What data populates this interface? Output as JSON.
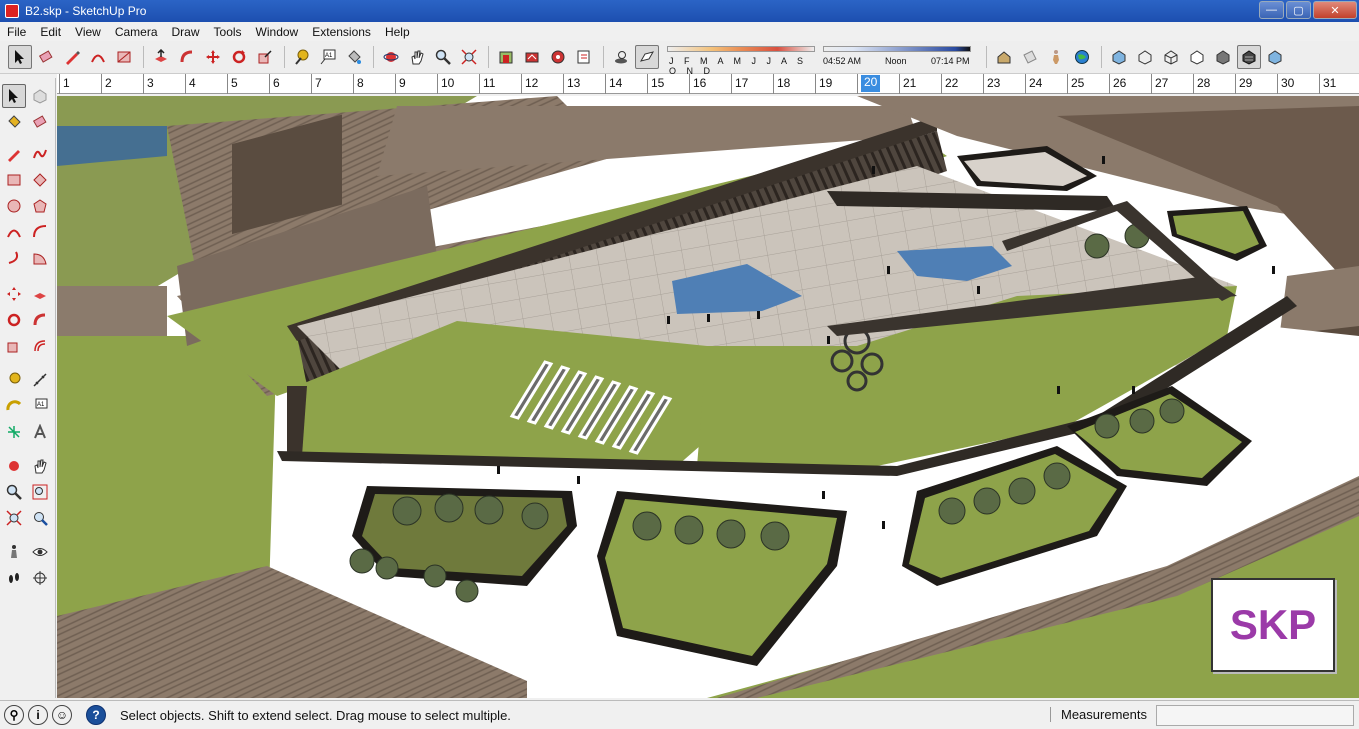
{
  "window": {
    "title": "B2.skp - SketchUp Pro",
    "minimize": "—",
    "maximize": "▢",
    "close": "✕"
  },
  "menu": [
    "File",
    "Edit",
    "View",
    "Camera",
    "Draw",
    "Tools",
    "Window",
    "Extensions",
    "Help"
  ],
  "shadows": {
    "months": "J F M A M J J A S O N D",
    "time_start": "04:52 AM",
    "time_mid": "Noon",
    "time_end": "07:14 PM"
  },
  "ruler": {
    "numbers": [
      "1",
      "2",
      "3",
      "4",
      "5",
      "6",
      "7",
      "8",
      "9",
      "10",
      "11",
      "12",
      "13",
      "14",
      "15",
      "16",
      "17",
      "18",
      "19",
      "20",
      "21",
      "22",
      "23",
      "24",
      "25",
      "26",
      "27",
      "28",
      "29",
      "30",
      "31"
    ],
    "current": "20"
  },
  "viewport": {
    "badge": "SKP"
  },
  "status": {
    "text": "Select objects. Shift to extend select. Drag mouse to select multiple.",
    "measurements_label": "Measurements",
    "measurements_value": ""
  },
  "colors": {
    "grass": "#8ea34a",
    "paving": "#c9c2b9",
    "roof_wood": "#8a7766",
    "water": "#4f7fb5",
    "title_bar": "#1d4fb0",
    "ruler_highlight": "#3a8de0"
  }
}
